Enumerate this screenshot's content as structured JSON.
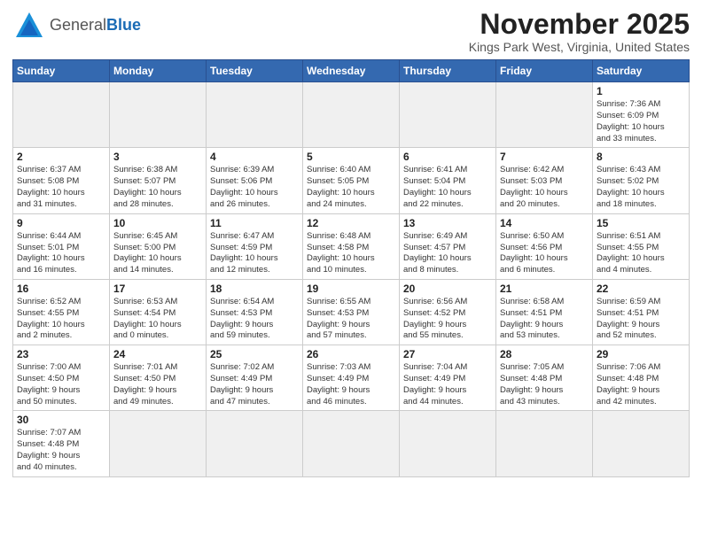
{
  "logo": {
    "text_general": "General",
    "text_blue": "Blue"
  },
  "header": {
    "month": "November 2025",
    "location": "Kings Park West, Virginia, United States"
  },
  "weekdays": [
    "Sunday",
    "Monday",
    "Tuesday",
    "Wednesday",
    "Thursday",
    "Friday",
    "Saturday"
  ],
  "weeks": [
    [
      {
        "day": "",
        "info": "",
        "empty": true
      },
      {
        "day": "",
        "info": "",
        "empty": true
      },
      {
        "day": "",
        "info": "",
        "empty": true
      },
      {
        "day": "",
        "info": "",
        "empty": true
      },
      {
        "day": "",
        "info": "",
        "empty": true
      },
      {
        "day": "",
        "info": "",
        "empty": true
      },
      {
        "day": "1",
        "info": "Sunrise: 7:36 AM\nSunset: 6:09 PM\nDaylight: 10 hours\nand 33 minutes."
      }
    ],
    [
      {
        "day": "2",
        "info": "Sunrise: 6:37 AM\nSunset: 5:08 PM\nDaylight: 10 hours\nand 31 minutes."
      },
      {
        "day": "3",
        "info": "Sunrise: 6:38 AM\nSunset: 5:07 PM\nDaylight: 10 hours\nand 28 minutes."
      },
      {
        "day": "4",
        "info": "Sunrise: 6:39 AM\nSunset: 5:06 PM\nDaylight: 10 hours\nand 26 minutes."
      },
      {
        "day": "5",
        "info": "Sunrise: 6:40 AM\nSunset: 5:05 PM\nDaylight: 10 hours\nand 24 minutes."
      },
      {
        "day": "6",
        "info": "Sunrise: 6:41 AM\nSunset: 5:04 PM\nDaylight: 10 hours\nand 22 minutes."
      },
      {
        "day": "7",
        "info": "Sunrise: 6:42 AM\nSunset: 5:03 PM\nDaylight: 10 hours\nand 20 minutes."
      },
      {
        "day": "8",
        "info": "Sunrise: 6:43 AM\nSunset: 5:02 PM\nDaylight: 10 hours\nand 18 minutes."
      }
    ],
    [
      {
        "day": "9",
        "info": "Sunrise: 6:44 AM\nSunset: 5:01 PM\nDaylight: 10 hours\nand 16 minutes."
      },
      {
        "day": "10",
        "info": "Sunrise: 6:45 AM\nSunset: 5:00 PM\nDaylight: 10 hours\nand 14 minutes."
      },
      {
        "day": "11",
        "info": "Sunrise: 6:47 AM\nSunset: 4:59 PM\nDaylight: 10 hours\nand 12 minutes."
      },
      {
        "day": "12",
        "info": "Sunrise: 6:48 AM\nSunset: 4:58 PM\nDaylight: 10 hours\nand 10 minutes."
      },
      {
        "day": "13",
        "info": "Sunrise: 6:49 AM\nSunset: 4:57 PM\nDaylight: 10 hours\nand 8 minutes."
      },
      {
        "day": "14",
        "info": "Sunrise: 6:50 AM\nSunset: 4:56 PM\nDaylight: 10 hours\nand 6 minutes."
      },
      {
        "day": "15",
        "info": "Sunrise: 6:51 AM\nSunset: 4:55 PM\nDaylight: 10 hours\nand 4 minutes."
      }
    ],
    [
      {
        "day": "16",
        "info": "Sunrise: 6:52 AM\nSunset: 4:55 PM\nDaylight: 10 hours\nand 2 minutes."
      },
      {
        "day": "17",
        "info": "Sunrise: 6:53 AM\nSunset: 4:54 PM\nDaylight: 10 hours\nand 0 minutes."
      },
      {
        "day": "18",
        "info": "Sunrise: 6:54 AM\nSunset: 4:53 PM\nDaylight: 9 hours\nand 59 minutes."
      },
      {
        "day": "19",
        "info": "Sunrise: 6:55 AM\nSunset: 4:53 PM\nDaylight: 9 hours\nand 57 minutes."
      },
      {
        "day": "20",
        "info": "Sunrise: 6:56 AM\nSunset: 4:52 PM\nDaylight: 9 hours\nand 55 minutes."
      },
      {
        "day": "21",
        "info": "Sunrise: 6:58 AM\nSunset: 4:51 PM\nDaylight: 9 hours\nand 53 minutes."
      },
      {
        "day": "22",
        "info": "Sunrise: 6:59 AM\nSunset: 4:51 PM\nDaylight: 9 hours\nand 52 minutes."
      }
    ],
    [
      {
        "day": "23",
        "info": "Sunrise: 7:00 AM\nSunset: 4:50 PM\nDaylight: 9 hours\nand 50 minutes."
      },
      {
        "day": "24",
        "info": "Sunrise: 7:01 AM\nSunset: 4:50 PM\nDaylight: 9 hours\nand 49 minutes."
      },
      {
        "day": "25",
        "info": "Sunrise: 7:02 AM\nSunset: 4:49 PM\nDaylight: 9 hours\nand 47 minutes."
      },
      {
        "day": "26",
        "info": "Sunrise: 7:03 AM\nSunset: 4:49 PM\nDaylight: 9 hours\nand 46 minutes."
      },
      {
        "day": "27",
        "info": "Sunrise: 7:04 AM\nSunset: 4:49 PM\nDaylight: 9 hours\nand 44 minutes."
      },
      {
        "day": "28",
        "info": "Sunrise: 7:05 AM\nSunset: 4:48 PM\nDaylight: 9 hours\nand 43 minutes."
      },
      {
        "day": "29",
        "info": "Sunrise: 7:06 AM\nSunset: 4:48 PM\nDaylight: 9 hours\nand 42 minutes."
      }
    ],
    [
      {
        "day": "30",
        "info": "Sunrise: 7:07 AM\nSunset: 4:48 PM\nDaylight: 9 hours\nand 40 minutes.",
        "last": true
      },
      {
        "day": "",
        "info": "",
        "empty": true,
        "last": true
      },
      {
        "day": "",
        "info": "",
        "empty": true,
        "last": true
      },
      {
        "day": "",
        "info": "",
        "empty": true,
        "last": true
      },
      {
        "day": "",
        "info": "",
        "empty": true,
        "last": true
      },
      {
        "day": "",
        "info": "",
        "empty": true,
        "last": true
      },
      {
        "day": "",
        "info": "",
        "empty": true,
        "last": true
      }
    ]
  ]
}
